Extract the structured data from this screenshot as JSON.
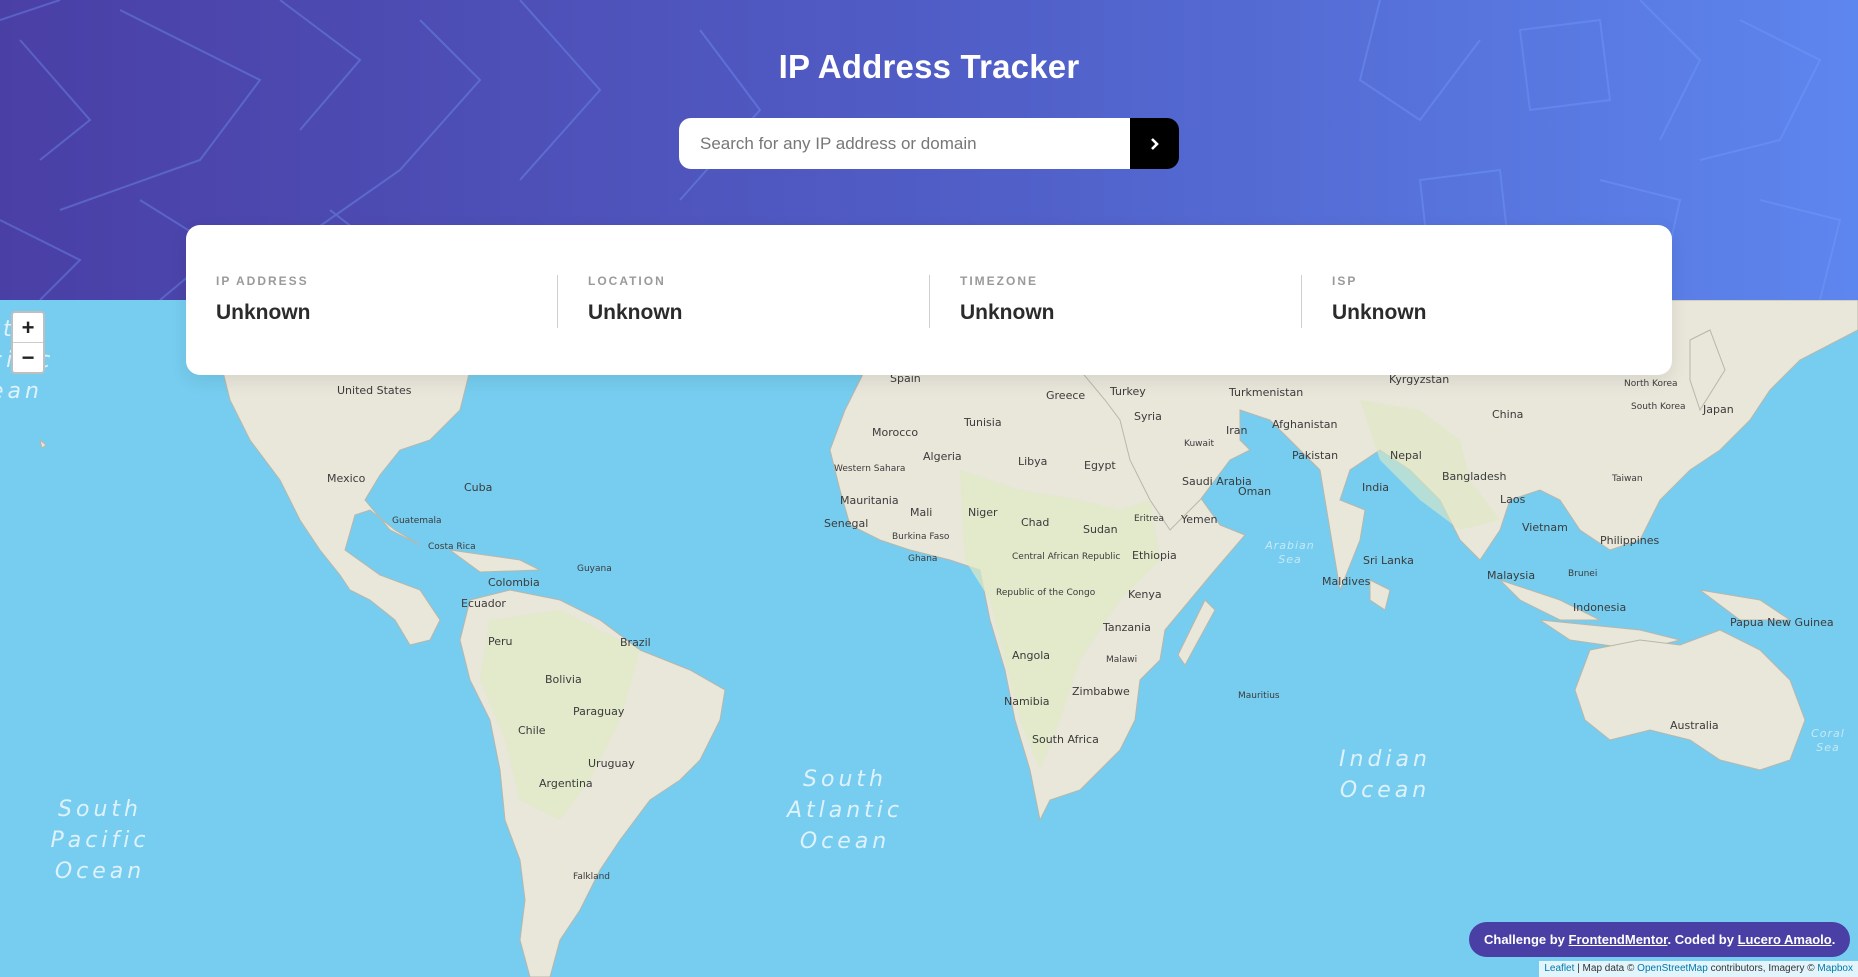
{
  "header": {
    "title": "IP Address Tracker",
    "search_placeholder": "Search for any IP address or domain",
    "search_value": "",
    "submit_icon": "chevron-right-icon"
  },
  "info": {
    "ip": {
      "label": "IP ADDRESS",
      "value": "Unknown"
    },
    "location": {
      "label": "LOCATION",
      "value": "Unknown"
    },
    "timezone": {
      "label": "TIMEZONE",
      "value": "Unknown"
    },
    "isp": {
      "label": "ISP",
      "value": "Unknown"
    }
  },
  "map": {
    "zoom_in": "+",
    "zoom_out": "−",
    "countries": [
      "United States",
      "Mexico",
      "Cuba",
      "Guatemala",
      "Costa Rica",
      "Colombia",
      "Guyana",
      "Ecuador",
      "Peru",
      "Brazil",
      "Bolivia",
      "Paraguay",
      "Chile",
      "Uruguay",
      "Argentina",
      "Falkland",
      "Spain",
      "Morocco",
      "Tunisia",
      "Algeria",
      "Libya",
      "Egypt",
      "Western Sahara",
      "Mauritania",
      "Mali",
      "Niger",
      "Chad",
      "Sudan",
      "Senegal",
      "Burkina Faso",
      "Ghana",
      "Central African Republic",
      "Republic of the Congo",
      "Eritrea",
      "Ethiopia",
      "Kenya",
      "Tanzania",
      "Angola",
      "Malawi",
      "Namibia",
      "Zimbabwe",
      "South Africa",
      "Mauritius",
      "Greece",
      "Turkey",
      "Syria",
      "Kuwait",
      "Iran",
      "Saudi Arabia",
      "Oman",
      "Yemen",
      "Turkmenistan",
      "Afghanistan",
      "Pakistan",
      "Nepal",
      "India",
      "Bangladesh",
      "Sri Lanka",
      "Maldives",
      "Kyrgyzstan",
      "China",
      "North Korea",
      "South Korea",
      "Japan",
      "Taiwan",
      "Laos",
      "Vietnam",
      "Philippines",
      "Malaysia",
      "Brunei",
      "Indonesia",
      "Papua New Guinea",
      "Australia"
    ],
    "oceans": {
      "north_pacific": "rth\ncific\nean",
      "atlantic": "Atlantic\nOcean",
      "south_pacific": "South\nPacific\nOcean",
      "south_atlantic": "South\nAtlantic\nOcean",
      "indian": "Indian\nOcean",
      "arabian": "Arabian\nSea",
      "coral": "Coral\nSea"
    }
  },
  "footer": {
    "credit_prefix": "Challenge by",
    "credit_fm": "FrontendMentor",
    "credit_mid": ". Coded by",
    "credit_author": "Lucero Amaolo",
    "credit_end": ".",
    "attr_leaflet": "Leaflet",
    "attr_mid": "| Map data ©",
    "attr_osm": "OpenStreetMap",
    "attr_contrib": "contributors, Imagery ©",
    "attr_mapbox": "Mapbox"
  },
  "colors": {
    "header_start": "#4a3fa5",
    "header_end": "#5d86ee",
    "ocean": "#76cdef",
    "button": "#000000",
    "credit_bg": "#4a3fa5"
  }
}
